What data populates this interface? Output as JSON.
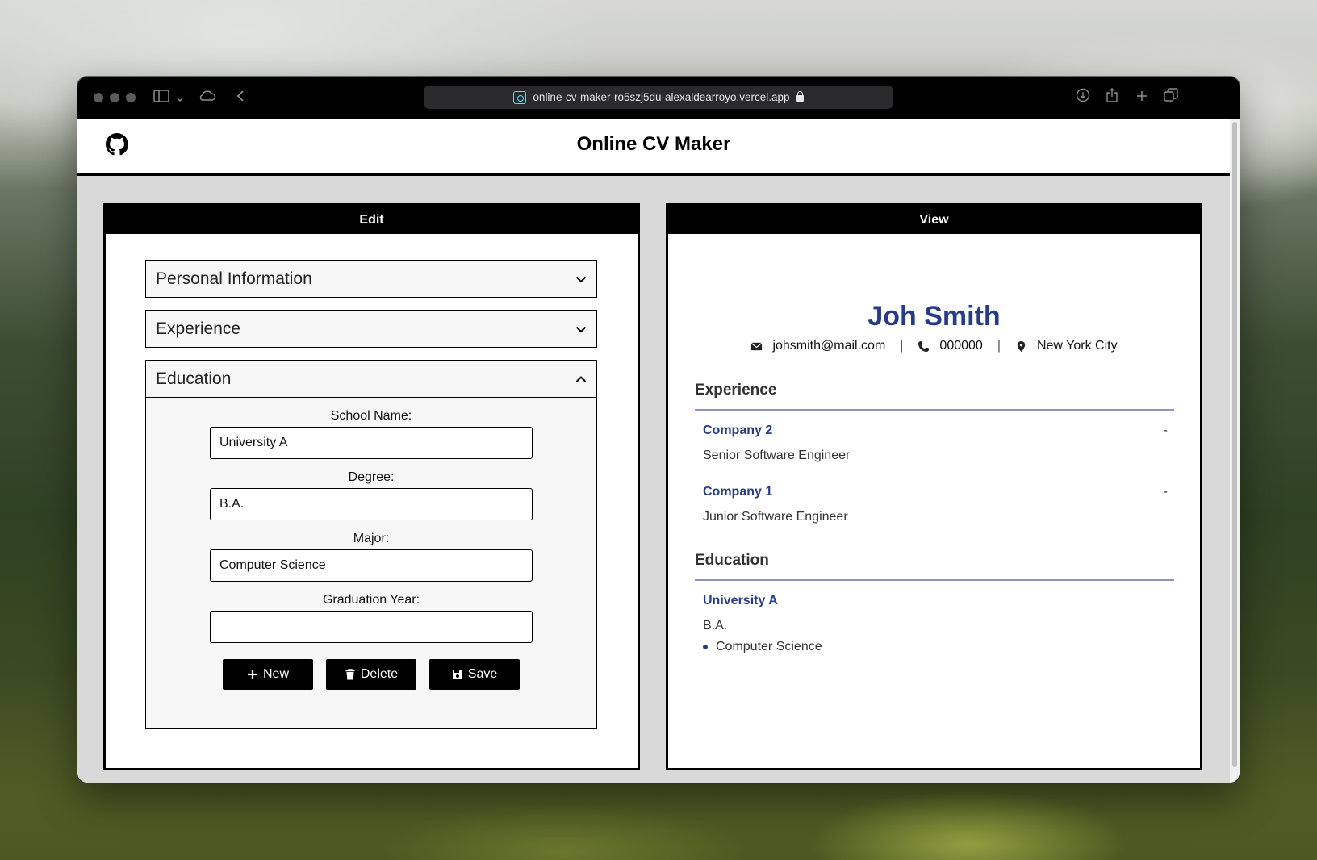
{
  "browser": {
    "url": "online-cv-maker-ro5szj5du-alexaldearroyo.vercel.app"
  },
  "app": {
    "title": "Online CV Maker"
  },
  "edit_panel": {
    "header": "Edit",
    "sections": [
      {
        "label": "Personal Information",
        "expanded": false
      },
      {
        "label": "Experience",
        "expanded": false
      },
      {
        "label": "Education",
        "expanded": true
      }
    ],
    "education_form": {
      "school_label": "School Name:",
      "school_value": "University A",
      "degree_label": "Degree:",
      "degree_value": "B.A.",
      "major_label": "Major:",
      "major_value": "Computer Science",
      "year_label": "Graduation Year:",
      "year_value": ""
    },
    "buttons": {
      "new": "New",
      "delete": "Delete",
      "save": "Save"
    }
  },
  "view_panel": {
    "header": "View",
    "name": "Joh Smith",
    "email": "johsmith@mail.com",
    "phone": "000000",
    "location": "New York City",
    "separator": "|",
    "experience_title": "Experience",
    "experience": [
      {
        "company": "Company 2",
        "dates": "-",
        "position": "Senior Software Engineer"
      },
      {
        "company": "Company 1",
        "dates": "-",
        "position": "Junior Software Engineer"
      }
    ],
    "education_title": "Education",
    "education": [
      {
        "school": "University A",
        "degree": "B.A.",
        "major": "Computer Science"
      }
    ]
  },
  "colors": {
    "accent_blue": "#263b8a",
    "divider": "#8795c7"
  }
}
